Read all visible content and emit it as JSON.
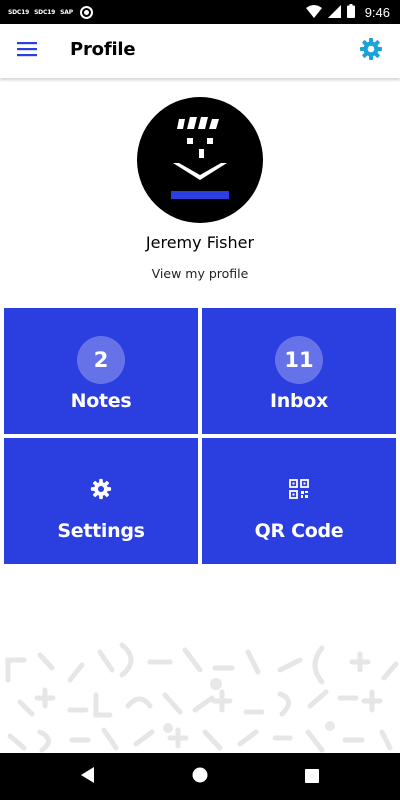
{
  "status_bar": {
    "time": "9:46",
    "notification_tags": [
      "SDC19",
      "SDC19",
      "SAP"
    ]
  },
  "app_bar": {
    "title": "Profile",
    "menu_icon": "hamburger-menu-icon",
    "settings_icon": "gear-icon",
    "accent_color": "#2b3ee0",
    "settings_icon_color": "#1aa3d9"
  },
  "profile": {
    "name": "Jeremy Fisher",
    "link": "View my profile",
    "avatar_icon": "avatar-face-icon"
  },
  "tiles": {
    "color": "#2b3ee0",
    "notes": {
      "count": "2",
      "label": "Notes"
    },
    "inbox": {
      "count": "11",
      "label": "Inbox"
    },
    "settings": {
      "label": "Settings",
      "icon": "gear-icon"
    },
    "qr": {
      "label": "QR Code",
      "icon": "qr-code-icon"
    }
  },
  "nav_bar": {
    "back_icon": "back-triangle-icon",
    "home_icon": "home-circle-icon",
    "recents_icon": "recents-square-icon"
  }
}
